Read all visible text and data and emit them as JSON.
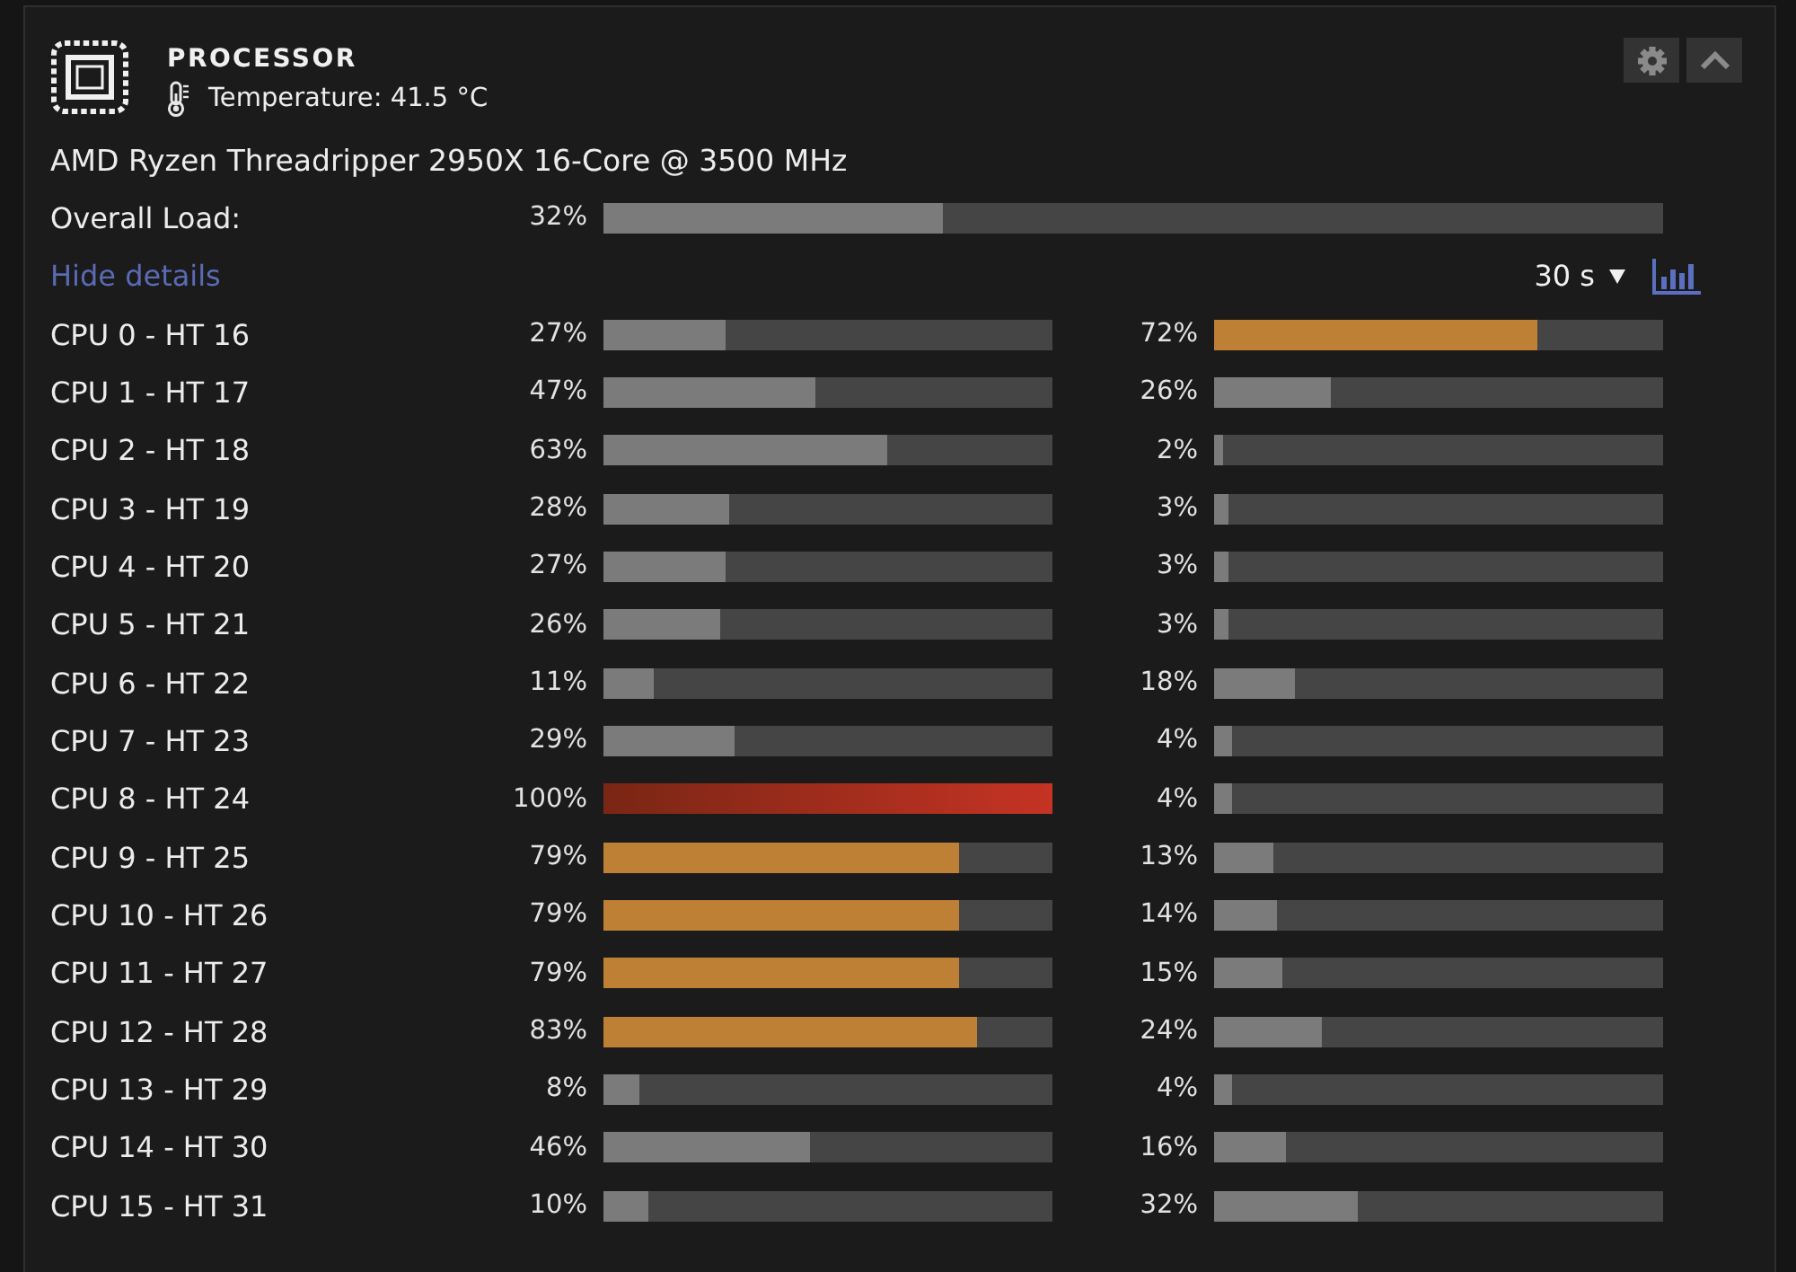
{
  "panel": {
    "title": "PROCESSOR",
    "temperature": "Temperature: 41.5 °C",
    "model": "AMD Ryzen Threadripper 2950X 16-Core @ 3500 MHz",
    "overall": {
      "label": "Overall Load:",
      "reading": "32%",
      "level": 0.32
    },
    "details_link": "Hide details",
    "interval": "30 s",
    "cores": [
      {
        "label": "CPU 0 - HT 16",
        "threads": [
          {
            "reading": "27%",
            "level": 0.27
          },
          {
            "reading": "72%",
            "level": 0.72
          }
        ]
      },
      {
        "label": "CPU 1 - HT 17",
        "threads": [
          {
            "reading": "47%",
            "level": 0.47
          },
          {
            "reading": "26%",
            "level": 0.26
          }
        ]
      },
      {
        "label": "CPU 2 - HT 18",
        "threads": [
          {
            "reading": "63%",
            "level": 0.63
          },
          {
            "reading": "2%",
            "level": 0.02
          }
        ]
      },
      {
        "label": "CPU 3 - HT 19",
        "threads": [
          {
            "reading": "28%",
            "level": 0.28
          },
          {
            "reading": "3%",
            "level": 0.03
          }
        ]
      },
      {
        "label": "CPU 4 - HT 20",
        "threads": [
          {
            "reading": "27%",
            "level": 0.27
          },
          {
            "reading": "3%",
            "level": 0.03
          }
        ]
      },
      {
        "label": "CPU 5 - HT 21",
        "threads": [
          {
            "reading": "26%",
            "level": 0.26
          },
          {
            "reading": "3%",
            "level": 0.03
          }
        ]
      },
      {
        "label": "CPU 6 - HT 22",
        "threads": [
          {
            "reading": "11%",
            "level": 0.11
          },
          {
            "reading": "18%",
            "level": 0.18
          }
        ]
      },
      {
        "label": "CPU 7 - HT 23",
        "threads": [
          {
            "reading": "29%",
            "level": 0.29
          },
          {
            "reading": "4%",
            "level": 0.04
          }
        ]
      },
      {
        "label": "CPU 8 - HT 24",
        "threads": [
          {
            "reading": "100%",
            "level": 1.0
          },
          {
            "reading": "4%",
            "level": 0.04
          }
        ]
      },
      {
        "label": "CPU 9 - HT 25",
        "threads": [
          {
            "reading": "79%",
            "level": 0.79
          },
          {
            "reading": "13%",
            "level": 0.13
          }
        ]
      },
      {
        "label": "CPU 10 - HT 26",
        "threads": [
          {
            "reading": "79%",
            "level": 0.79
          },
          {
            "reading": "14%",
            "level": 0.14
          }
        ]
      },
      {
        "label": "CPU 11 - HT 27",
        "threads": [
          {
            "reading": "79%",
            "level": 0.79
          },
          {
            "reading": "15%",
            "level": 0.15
          }
        ]
      },
      {
        "label": "CPU 12 - HT 28",
        "threads": [
          {
            "reading": "83%",
            "level": 0.83
          },
          {
            "reading": "24%",
            "level": 0.24
          }
        ]
      },
      {
        "label": "CPU 13 - HT 29",
        "threads": [
          {
            "reading": "8%",
            "level": 0.08
          },
          {
            "reading": "4%",
            "level": 0.04
          }
        ]
      },
      {
        "label": "CPU 14 - HT 30",
        "threads": [
          {
            "reading": "46%",
            "level": 0.46
          },
          {
            "reading": "16%",
            "level": 0.16
          }
        ]
      },
      {
        "label": "CPU 15 - HT 31",
        "threads": [
          {
            "reading": "10%",
            "level": 0.1
          },
          {
            "reading": "32%",
            "level": 0.32
          }
        ]
      }
    ]
  }
}
